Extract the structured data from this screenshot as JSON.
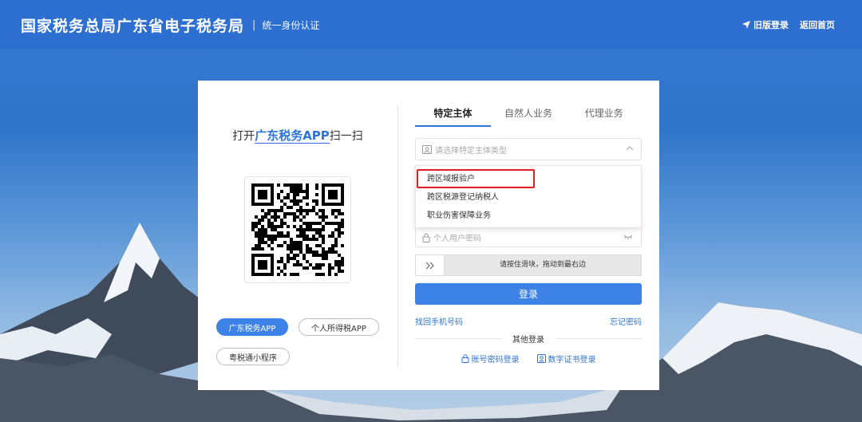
{
  "header": {
    "title": "国家税务总局广东省电子税务局",
    "separator": "|",
    "subtitle": "统一身份认证",
    "links": {
      "old_login": "旧版登录",
      "home": "返回首页"
    }
  },
  "left_panel": {
    "scan_prefix": "打开",
    "scan_app": "广东税务APP",
    "scan_suffix": "扫一扫",
    "chips": {
      "gd_tax_app": "广东税务APP",
      "personal_tax_app": "个人所得税APP",
      "mini_program": "粤税通小程序"
    }
  },
  "tabs": [
    "特定主体",
    "自然人业务",
    "代理业务"
  ],
  "form": {
    "subject_type_placeholder": "请选择特定主体类型",
    "dropdown_options": [
      "跨区域报验户",
      "跨区税源登记纳税人",
      "职业伤害保障业务"
    ],
    "password_placeholder": "个人用户密码",
    "slider_text": "请按住滑块，拖动到最右边",
    "login_button": "登录",
    "retrieve_phone": "找回手机号码",
    "forgot_password": "忘记密码",
    "other_login": "其他登录",
    "account_login": "账号密码登录",
    "cert_login": "数字证书登录"
  },
  "colors": {
    "primary": "#2e73d8",
    "header_bg": "#2d6fd1",
    "highlight": "#e02020"
  }
}
